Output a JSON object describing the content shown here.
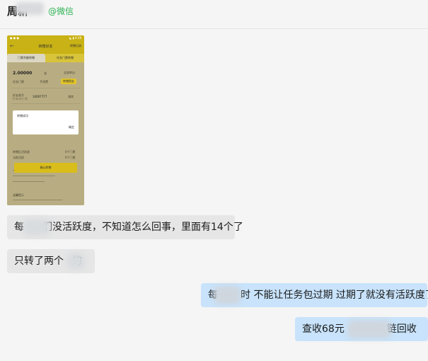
{
  "header": {
    "contact_name": "周新",
    "wechat_tag": "@微信"
  },
  "screenshot": {
    "status_time": "● ● ●",
    "status_right": "◣ ▮ 4:38",
    "nav_title": "转赠好友",
    "nav_more": "转赠记录",
    "tab_left": "门票余额转赠",
    "tab_right": "任务门票转赠",
    "amount": "2.00000",
    "unit": "张",
    "all_btn": "全部转出",
    "fee_label": "任务门票",
    "fee_value": "手续费",
    "transfer_btn": "转赠朋友",
    "friend_label": "好友账号",
    "friend_hint": "Friend's ID",
    "friend_id": "10007777",
    "clear_label": "清除",
    "dialog_message": "转赠成功",
    "dialog_ok": "确定",
    "info_left_1": "转赠后活跃度",
    "info_right_1": "0个门票",
    "info_left_2": "当前活跃",
    "info_right_2": "0个门票",
    "confirm_btn": "确认转赠",
    "notes_title": "温馨提示"
  },
  "messages": [
    {
      "side": "left",
      "text_a": "每",
      "text_b": "们没活跃度，不知道怎么回事，里面有14个了"
    },
    {
      "side": "left",
      "text_a": "只转了两个",
      "text_b": "的"
    },
    {
      "side": "right",
      "text_a": "每",
      "text_b": "时  不能让任务包过期  过期了就没有活跃度了"
    },
    {
      "side": "right",
      "text_a": "查收68元",
      "text_b": "链回收"
    }
  ]
}
